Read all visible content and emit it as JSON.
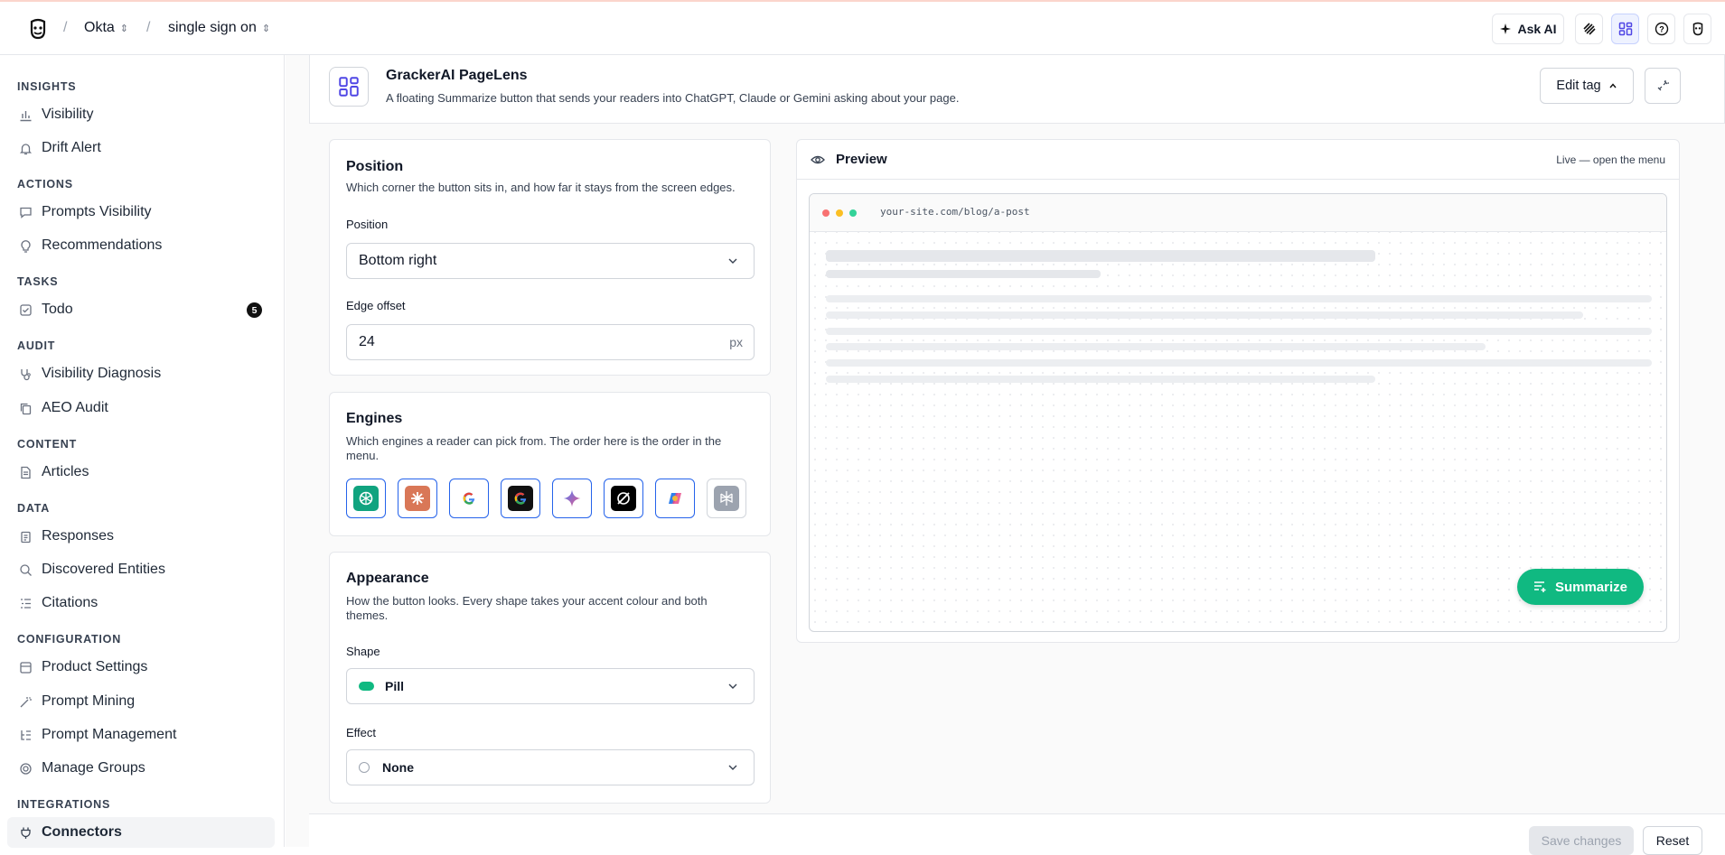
{
  "breadcrumb": {
    "org": "Okta",
    "project": "single sign on"
  },
  "header": {
    "ask_ai": "Ask AI"
  },
  "sidebar": {
    "sections": [
      {
        "title": "INSIGHTS",
        "items": [
          {
            "label": "Visibility"
          },
          {
            "label": "Drift Alert"
          }
        ]
      },
      {
        "title": "ACTIONS",
        "items": [
          {
            "label": "Prompts Visibility"
          },
          {
            "label": "Recommendations"
          }
        ]
      },
      {
        "title": "TASKS",
        "items": [
          {
            "label": "Todo",
            "badge": "5"
          }
        ]
      },
      {
        "title": "AUDIT",
        "items": [
          {
            "label": "Visibility Diagnosis"
          },
          {
            "label": "AEO Audit"
          }
        ]
      },
      {
        "title": "CONTENT",
        "items": [
          {
            "label": "Articles"
          }
        ]
      },
      {
        "title": "DATA",
        "items": [
          {
            "label": "Responses"
          },
          {
            "label": "Discovered Entities"
          },
          {
            "label": "Citations"
          }
        ]
      },
      {
        "title": "CONFIGURATION",
        "items": [
          {
            "label": "Product Settings"
          },
          {
            "label": "Prompt Mining"
          },
          {
            "label": "Prompt Management"
          },
          {
            "label": "Manage Groups"
          }
        ]
      },
      {
        "title": "INTEGRATIONS",
        "items": [
          {
            "label": "Connectors"
          }
        ]
      }
    ],
    "active": "Connectors"
  },
  "tag": {
    "title": "GrackerAI PageLens",
    "description": "A floating Summarize button that sends your readers into ChatGPT, Claude or Gemini asking about your page.",
    "edit_label": "Edit tag"
  },
  "position": {
    "title": "Position",
    "description": "Which corner the button sits in, and how far it stays from the screen edges.",
    "position_label": "Position",
    "position_value": "Bottom right",
    "offset_label": "Edge offset",
    "offset_value": "24",
    "offset_unit": "px"
  },
  "engines": {
    "title": "Engines",
    "description": "Which engines a reader can pick from. The order here is the order in the menu.",
    "list": [
      {
        "icon": "chatgpt-icon",
        "color": "#10a37f",
        "selected": true
      },
      {
        "icon": "claude-icon",
        "color": "#d97757",
        "selected": true
      },
      {
        "icon": "google-icon",
        "color": "#4285f4",
        "selected": true
      },
      {
        "icon": "google-ai-mode-icon",
        "color": "#111111",
        "selected": true
      },
      {
        "icon": "gemini-icon",
        "color": "#4f7cf6",
        "selected": true
      },
      {
        "icon": "grok-icon",
        "color": "#000000",
        "selected": true
      },
      {
        "icon": "copilot-icon",
        "color": "#7b61ff",
        "selected": true
      },
      {
        "icon": "perplexity-icon",
        "color": "#9ca3af",
        "selected": false
      }
    ]
  },
  "appearance": {
    "title": "Appearance",
    "description": "How the button looks. Every shape takes your accent colour and both themes.",
    "shape_label": "Shape",
    "shape_value": "Pill",
    "effect_label": "Effect",
    "effect_value": "None",
    "accent": "#10b981"
  },
  "preview": {
    "title": "Preview",
    "hint": "Live — open the menu",
    "url": "your-site.com/blog/a-post",
    "button_label": "Summarize"
  },
  "footer": {
    "save": "Save changes",
    "reset": "Reset"
  }
}
